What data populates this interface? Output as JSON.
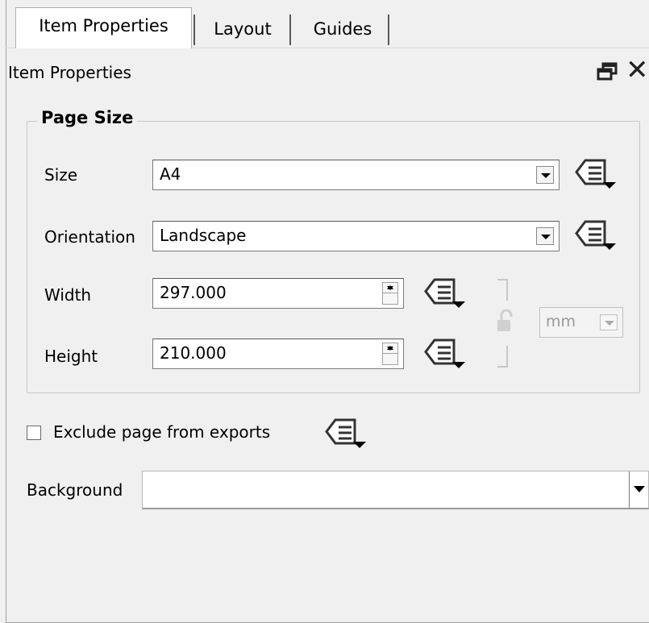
{
  "tabs": [
    {
      "label": "Item Properties",
      "active": true
    },
    {
      "label": "Layout",
      "active": false
    },
    {
      "label": "Guides",
      "active": false
    }
  ],
  "panel": {
    "title": "Item Properties",
    "dock_icon": "float-window-icon",
    "close_icon": "close-icon"
  },
  "page_size": {
    "group_title": "Page Size",
    "size_label": "Size",
    "size_value": "A4",
    "orientation_label": "Orientation",
    "orientation_value": "Landscape",
    "width_label": "Width",
    "width_value": "297.000",
    "height_label": "Height",
    "height_value": "210.000",
    "units_value": "mm",
    "lock_icon": "unlocked-padlock-icon",
    "data_defined_icon": "data-defined-override-icon"
  },
  "exclude_page": {
    "label": "Exclude page from exports",
    "checked": false
  },
  "background": {
    "label": "Background",
    "value": ""
  }
}
